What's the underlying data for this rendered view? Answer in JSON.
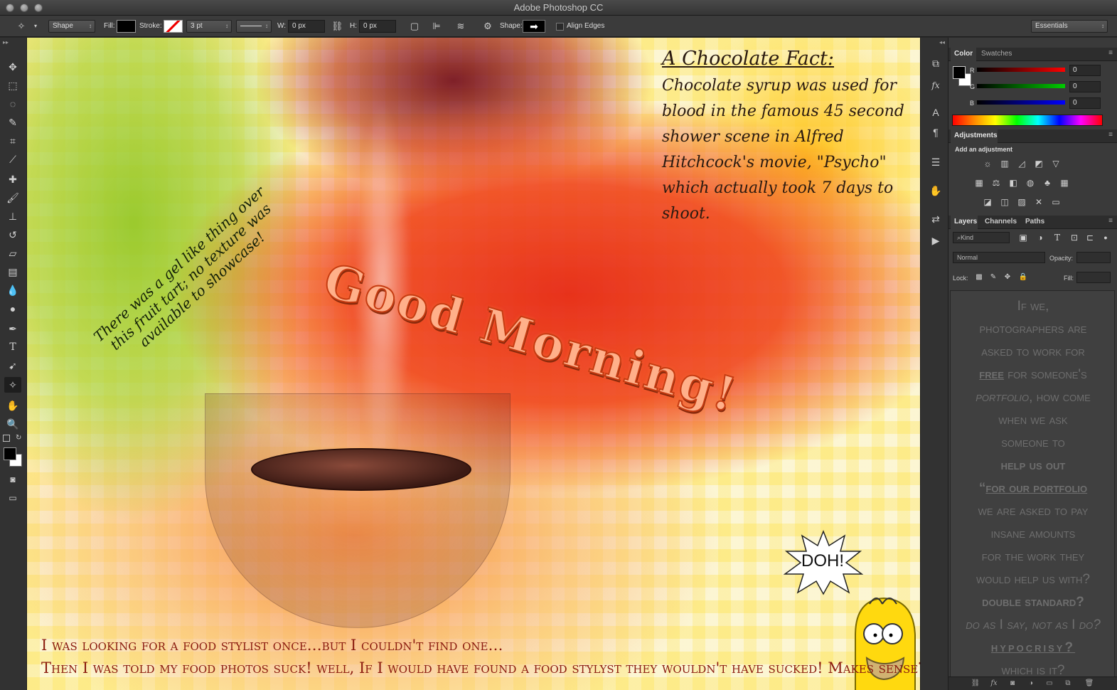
{
  "window": {
    "title": "Adobe Photoshop CC"
  },
  "options_bar": {
    "tool_mode": "Shape",
    "fill_label": "Fill:",
    "stroke_label": "Stroke:",
    "stroke_width": "3 pt",
    "width_label": "W:",
    "width_value": "0 px",
    "height_label": "H:",
    "height_value": "0 px",
    "shape_label": "Shape:",
    "align_edges_label": "Align Edges",
    "workspace": "Essentials"
  },
  "color_panel": {
    "tabs": [
      "Color",
      "Swatches"
    ],
    "channels": [
      {
        "name": "R",
        "value": "0"
      },
      {
        "name": "G",
        "value": "0"
      },
      {
        "name": "B",
        "value": "0"
      }
    ]
  },
  "adjustments_panel": {
    "tab": "Adjustments",
    "heading": "Add an adjustment"
  },
  "layers_panel": {
    "tabs": [
      "Layers",
      "Channels",
      "Paths"
    ],
    "filter_kind": "Kind",
    "blend_mode": "Normal",
    "opacity_label": "Opacity:",
    "lock_label": "Lock:",
    "fill_label": "Fill:"
  },
  "canvas": {
    "fact_title": "A Chocolate Fact:",
    "fact_body": "Chocolate syrup was used for blood in the famous 45 second shower scene in Alfred Hitchcock's movie, \"Psycho\" which actually took 7 days to shoot.",
    "gel_note": "There was a gel like thing over this fruit tart; no texture was available to showcase!",
    "headline": "Good Morning!",
    "doh": "DOH!",
    "line1": "I was looking for a food stylist once…but I couldn't find one…",
    "line2": "Then I was told my food photos suck! well, If I would have found a food stylyst they wouldn't have sucked! Makes sense?"
  },
  "poem": {
    "l1": "If we,",
    "l2": "photographers are",
    "l3": "asked to work for",
    "l4a": "free",
    "l4b": " for someone's",
    "l5a": "portfolio",
    "l5b": ", how come",
    "l6": "when we ask",
    "l7": "someone to",
    "l8": "help us out",
    "l9a": "“",
    "l9b": "for our portfolio",
    "l10": "we are asked to pay",
    "l11": "insane amounts",
    "l12": "for the work they",
    "l13": "would help us with?",
    "l14": "double standard?",
    "l15a": "do as ",
    "l15b": "I",
    "l15c": " say, not as ",
    "l15d": "I",
    "l15e": " do?",
    "l16": "hypocrisy?",
    "l17": "which is it?"
  }
}
